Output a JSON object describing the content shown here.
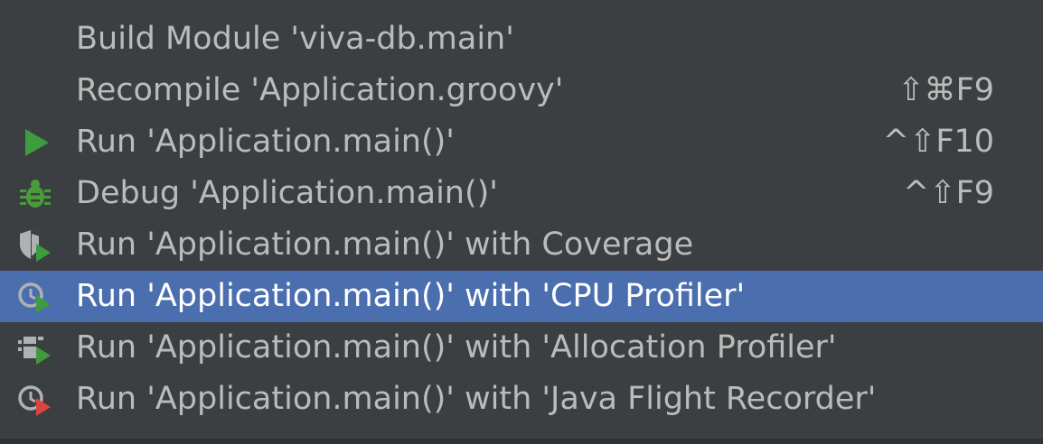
{
  "menu": {
    "items": [
      {
        "label": "Build Module 'viva-db.main'",
        "shortcut": "",
        "icon": "none"
      },
      {
        "label": "Recompile 'Application.groovy'",
        "shortcut": "⇧⌘F9",
        "icon": "none"
      },
      {
        "label": "Run 'Application.main()'",
        "shortcut": "^⇧F10",
        "icon": "run-icon"
      },
      {
        "label": "Debug 'Application.main()'",
        "shortcut": "^⇧F9",
        "icon": "debug-icon"
      },
      {
        "label": "Run 'Application.main()' with Coverage",
        "shortcut": "",
        "icon": "coverage-icon"
      },
      {
        "label": "Run 'Application.main()' with 'CPU Profiler'",
        "shortcut": "",
        "icon": "cpu-profiler-icon",
        "selected": true
      },
      {
        "label": "Run 'Application.main()' with 'Allocation Profiler'",
        "shortcut": "",
        "icon": "allocation-profiler-icon"
      },
      {
        "label": "Run 'Application.main()' with 'Java Flight Recorder'",
        "shortcut": "",
        "icon": "flight-recorder-icon"
      }
    ]
  },
  "colors": {
    "background": "#3c3f41",
    "selection": "#4b6eaf",
    "text": "#bbbbbb",
    "selected_text": "#ffffff",
    "run_green": "#3e9b3e",
    "debug_green": "#4a9c3a",
    "recorder_red": "#d9463e"
  }
}
